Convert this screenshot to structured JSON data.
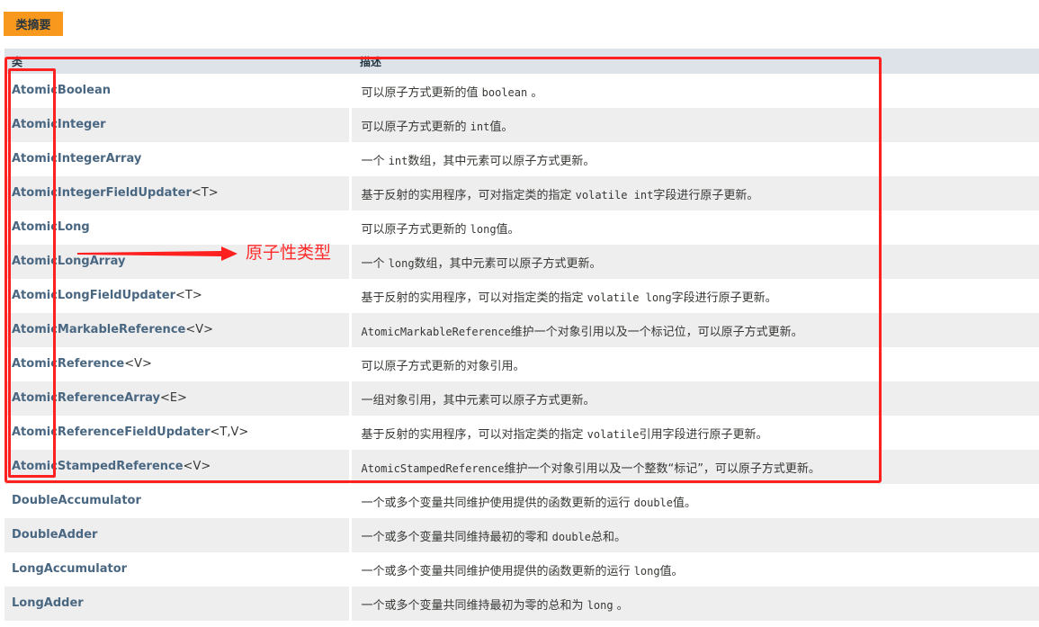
{
  "caption": "类摘要",
  "headers": {
    "class": "类",
    "description": "描述"
  },
  "rows": [
    {
      "name": "AtomicBoolean",
      "type_params": "",
      "desc_before": "可以原子方式更新的值 ",
      "desc_code": "boolean",
      "desc_after": " 。"
    },
    {
      "name": "AtomicInteger",
      "type_params": "",
      "desc_before": "可以原子方式更新的 ",
      "desc_code": "int",
      "desc_after": "值。"
    },
    {
      "name": "AtomicIntegerArray",
      "type_params": "",
      "desc_before": "一个 ",
      "desc_code": "int",
      "desc_after": "数组，其中元素可以原子方式更新。"
    },
    {
      "name": "AtomicIntegerFieldUpdater",
      "type_params": "<T>",
      "desc_before": "基于反射的实用程序，可对指定类的指定 ",
      "desc_code": "volatile int",
      "desc_after": "字段进行原子更新。"
    },
    {
      "name": "AtomicLong",
      "type_params": "",
      "desc_before": "可以原子方式更新的 ",
      "desc_code": "long",
      "desc_after": "值。"
    },
    {
      "name": "AtomicLongArray",
      "type_params": "",
      "desc_before": "一个 ",
      "desc_code": "long",
      "desc_after": "数组，其中元素可以原子方式更新。"
    },
    {
      "name": "AtomicLongFieldUpdater",
      "type_params": "<T>",
      "desc_before": "基于反射的实用程序，可以对指定类的指定 ",
      "desc_code": "volatile long",
      "desc_after": "字段进行原子更新。"
    },
    {
      "name": "AtomicMarkableReference",
      "type_params": "<V>",
      "desc_before": "",
      "desc_code": "AtomicMarkableReference",
      "desc_after": "维护一个对象引用以及一个标记位，可以原子方式更新。"
    },
    {
      "name": "AtomicReference",
      "type_params": "<V>",
      "desc_before": "可以原子方式更新的对象引用。",
      "desc_code": "",
      "desc_after": ""
    },
    {
      "name": "AtomicReferenceArray",
      "type_params": "<E>",
      "desc_before": "一组对象引用，其中元素可以原子方式更新。",
      "desc_code": "",
      "desc_after": ""
    },
    {
      "name": "AtomicReferenceFieldUpdater",
      "type_params": "<T,V>",
      "desc_before": "基于反射的实用程序，可以对指定类的指定 ",
      "desc_code": "volatile",
      "desc_after": "引用字段进行原子更新。"
    },
    {
      "name": "AtomicStampedReference",
      "type_params": "<V>",
      "desc_before": "",
      "desc_code": "AtomicStampedReference",
      "desc_after": "维护一个对象引用以及一个整数“标记”，可以原子方式更新。"
    },
    {
      "name": "DoubleAccumulator",
      "type_params": "",
      "desc_before": "一个或多个变量共同维护使用提供的函数更新的运行 ",
      "desc_code": "double",
      "desc_after": "值。"
    },
    {
      "name": "DoubleAdder",
      "type_params": "",
      "desc_before": "一个或多个变量共同维持最初的零和 ",
      "desc_code": "double",
      "desc_after": "总和。"
    },
    {
      "name": "LongAccumulator",
      "type_params": "",
      "desc_before": "一个或多个变量共同维护使用提供的函数更新的运行 ",
      "desc_code": "long",
      "desc_after": "值。"
    },
    {
      "name": "LongAdder",
      "type_params": "",
      "desc_before": "一个或多个变量共同维持最初为零的总和为 ",
      "desc_code": "long",
      "desc_after": " 。"
    }
  ],
  "annotation": {
    "label": "原子性类型",
    "color": "#ff2020"
  },
  "colors": {
    "caption_bg": "#f8981d",
    "header_bg": "#dee3e9",
    "alt_row_bg": "#eeeeef",
    "link": "#4a6782"
  }
}
